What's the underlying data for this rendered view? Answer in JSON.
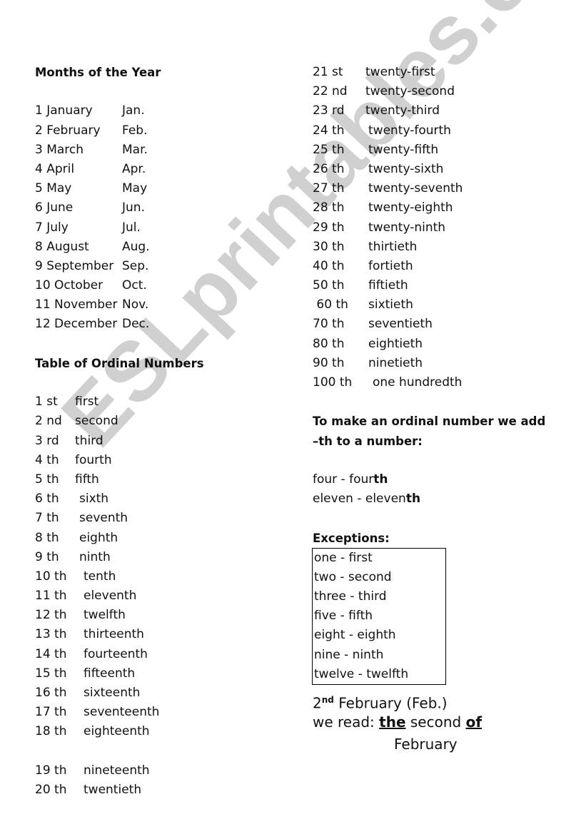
{
  "watermark": "ESLprintables.com",
  "months": {
    "heading": "Months of the Year",
    "items": [
      {
        "name": "1 January",
        "abbr": "Jan."
      },
      {
        "name": "2 February",
        "abbr": "Feb."
      },
      {
        "name": "3 March",
        "abbr": "Mar."
      },
      {
        "name": "4 April",
        "abbr": "Apr."
      },
      {
        "name": "5 May",
        "abbr": "May"
      },
      {
        "name": "6 June",
        "abbr": "Jun."
      },
      {
        "name": "7 July",
        "abbr": "Jul."
      },
      {
        "name": "8 August",
        "abbr": "Aug."
      },
      {
        "name": "9 September",
        "abbr": "Sep."
      },
      {
        "name": "10 October",
        "abbr": "Oct."
      },
      {
        "name": "11 November",
        "abbr": "Nov."
      },
      {
        "name": "12 December",
        "abbr": "Dec."
      }
    ]
  },
  "ordinals": {
    "heading": "Table of Ordinal Numbers",
    "items": [
      {
        "num": "1 st",
        "word": "first"
      },
      {
        "num": "2 nd",
        "word": "second"
      },
      {
        "num": "3 rd",
        "word": "third"
      },
      {
        "num": "4 th",
        "word": "fourth"
      },
      {
        "num": "5 th",
        "word": "fifth"
      },
      {
        "num": "6 th",
        "word": "sixth"
      },
      {
        "num": "7 th",
        "word": "seventh"
      },
      {
        "num": "8 th",
        "word": "eighth"
      },
      {
        "num": "9 th",
        "word": "ninth"
      },
      {
        "num": "10 th",
        "word": "tenth"
      },
      {
        "num": "11 th",
        "word": "eleventh"
      },
      {
        "num": "12 th",
        "word": "twelfth"
      },
      {
        "num": "13 th",
        "word": "thirteenth"
      },
      {
        "num": "14 th",
        "word": "fourteenth"
      },
      {
        "num": "15 th",
        "word": "fifteenth"
      },
      {
        "num": "16 th",
        "word": "sixteenth"
      },
      {
        "num": "17 th",
        "word": "seventeenth"
      },
      {
        "num": "18 th",
        "word": "eighteenth"
      },
      {
        "num": "19 th",
        "word": "nineteenth"
      },
      {
        "num": "20 th",
        "word": "twentieth"
      },
      {
        "num": "21 st",
        "word": "twenty-first"
      },
      {
        "num": "22 nd",
        "word": "twenty-second"
      },
      {
        "num": "23 rd",
        "word": "twenty-third"
      },
      {
        "num": "24 th",
        "word": "twenty-fourth"
      },
      {
        "num": "25 th",
        "word": "twenty-fifth"
      },
      {
        "num": "26 th",
        "word": "twenty-sixth"
      },
      {
        "num": "27 th",
        "word": "twenty-seventh"
      },
      {
        "num": "28 th",
        "word": "twenty-eighth"
      },
      {
        "num": "29 th",
        "word": "twenty-ninth"
      },
      {
        "num": "30 th",
        "word": "thirtieth"
      },
      {
        "num": "40 th",
        "word": "fortieth"
      },
      {
        "num": "50 th",
        "word": "fiftieth"
      },
      {
        "num": " 60 th",
        "word": "sixtieth"
      },
      {
        "num": "70 th",
        "word": "seventieth"
      },
      {
        "num": "80 th",
        "word": "eightieth"
      },
      {
        "num": "90 th",
        "word": "ninetieth"
      },
      {
        "num": "100 th",
        "word": "one hundredth"
      }
    ]
  },
  "rule": {
    "heading_line1": "To make an ordinal number we add",
    "heading_line2": "–th to a number:",
    "examples": [
      {
        "base": "four - four",
        "suffix": "th"
      },
      {
        "base": "eleven - eleven",
        "suffix": "th"
      }
    ]
  },
  "exceptions": {
    "heading": "Exceptions:",
    "items": [
      "one - first",
      "two - second",
      "three - third",
      "five - fifth",
      "eight - eighth",
      "nine - ninth",
      "twelve - twelfth"
    ]
  },
  "date_example": {
    "day": "2",
    "sup": "nd",
    "rest": " February (Feb.)",
    "read_prefix": "we read: ",
    "the": "the",
    "middle": " second ",
    "of": "of",
    "month": "February"
  }
}
